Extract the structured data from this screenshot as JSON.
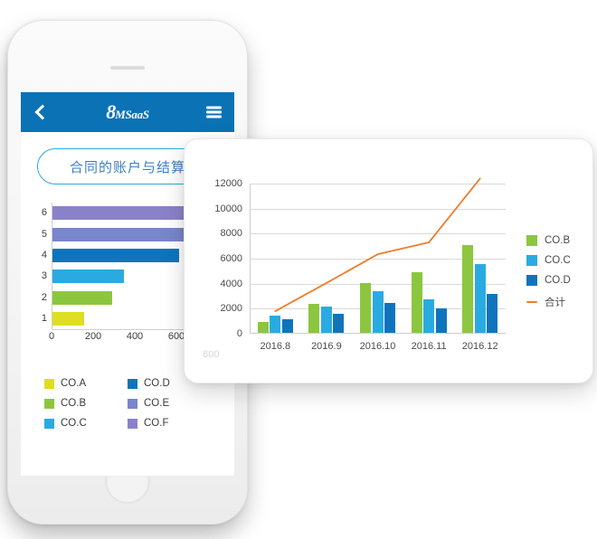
{
  "phone": {
    "header": {
      "back_icon": "chevron-left-icon",
      "logo_big": "8",
      "logo_small": "MSaaS",
      "menu_icon": "hamburger-menu-icon",
      "bg_color": "#0b72b5"
    },
    "title_pill": "合同的账户与结算",
    "bar_chart": {
      "type": "bar",
      "orientation": "horizontal",
      "categories": [
        "1",
        "2",
        "3",
        "4",
        "5",
        "6"
      ],
      "values": [
        150,
        285,
        345,
        610,
        700,
        730
      ],
      "xticks": [
        "0",
        "200",
        "400",
        "600"
      ],
      "xtick_hidden": "800",
      "xlim": [
        0,
        800
      ],
      "colors": [
        "#dede22",
        "#8cc63f",
        "#29abe2",
        "#0f74bc",
        "#7986cb",
        "#8a82c9"
      ]
    },
    "legend": [
      {
        "label": "CO.A",
        "color": "#dede22"
      },
      {
        "label": "CO.D",
        "color": "#0f74bc"
      },
      {
        "label": "CO.B",
        "color": "#8cc63f"
      },
      {
        "label": "CO.E",
        "color": "#7986cb"
      },
      {
        "label": "CO.C",
        "color": "#29abe2"
      },
      {
        "label": "CO.F",
        "color": "#8a82c9"
      }
    ]
  },
  "card": {
    "chart_data": {
      "type": "bar",
      "title": "",
      "xlabel": "",
      "ylabel": "",
      "categories": [
        "2016.8",
        "2016.9",
        "2016.10",
        "2016.11",
        "2016.12"
      ],
      "yticks": [
        "0",
        "2000",
        "4000",
        "6000",
        "8000",
        "10000",
        "12000"
      ],
      "ylim": [
        0,
        12000
      ],
      "grid": true,
      "legend_position": "right",
      "series": [
        {
          "name": "CO.B",
          "type": "bar",
          "color": "#8cc63f",
          "values": [
            850,
            2350,
            3980,
            4830,
            6980
          ]
        },
        {
          "name": "CO.C",
          "type": "bar",
          "color": "#29abe2",
          "values": [
            1400,
            2080,
            3350,
            2650,
            5500
          ]
        },
        {
          "name": "CO.D",
          "type": "bar",
          "color": "#0f74bc",
          "values": [
            1060,
            1500,
            2380,
            1980,
            3120
          ]
        },
        {
          "name": "合计",
          "type": "line",
          "color": "#f07d28",
          "values": [
            1800,
            4050,
            6350,
            7300,
            12400
          ]
        }
      ]
    },
    "legend": [
      {
        "label": "CO.B",
        "color": "#8cc63f",
        "kind": "box"
      },
      {
        "label": "CO.C",
        "color": "#29abe2",
        "kind": "box"
      },
      {
        "label": "CO.D",
        "color": "#0f74bc",
        "kind": "box"
      },
      {
        "label": "合计",
        "color": "#f07d28",
        "kind": "line"
      }
    ]
  },
  "ghost_label": "800"
}
